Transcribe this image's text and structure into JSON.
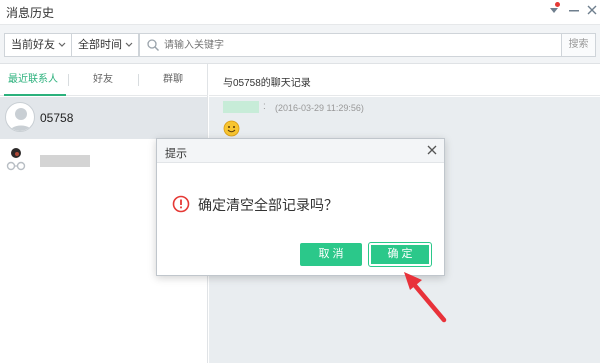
{
  "window": {
    "title": "消息历史"
  },
  "filters": {
    "friend_scope": "当前好友",
    "time_range": "全部时间",
    "search_placeholder": "请输入关键字",
    "search_button": "搜索"
  },
  "tabs": [
    {
      "label": "最近联系人",
      "active": true
    },
    {
      "label": "好友",
      "active": false
    },
    {
      "label": "群聊",
      "active": false
    }
  ],
  "contacts": [
    {
      "name": "05758",
      "selected": true
    },
    {
      "name": "",
      "selected": false
    }
  ],
  "chat": {
    "header": "与05758的聊天记录",
    "messages": [
      {
        "sender_separator": ":",
        "timestamp": "(2016-03-29 11:29:56)",
        "content_icon": "smile-emoji-icon"
      }
    ]
  },
  "dialog": {
    "title": "提示",
    "message": "确定清空全部记录吗？",
    "cancel_label": "取 消",
    "ok_label": "确 定"
  },
  "colors": {
    "accent_green": "#2bc88a",
    "warning_red": "#e53935",
    "annotation_red": "#e8323a"
  }
}
